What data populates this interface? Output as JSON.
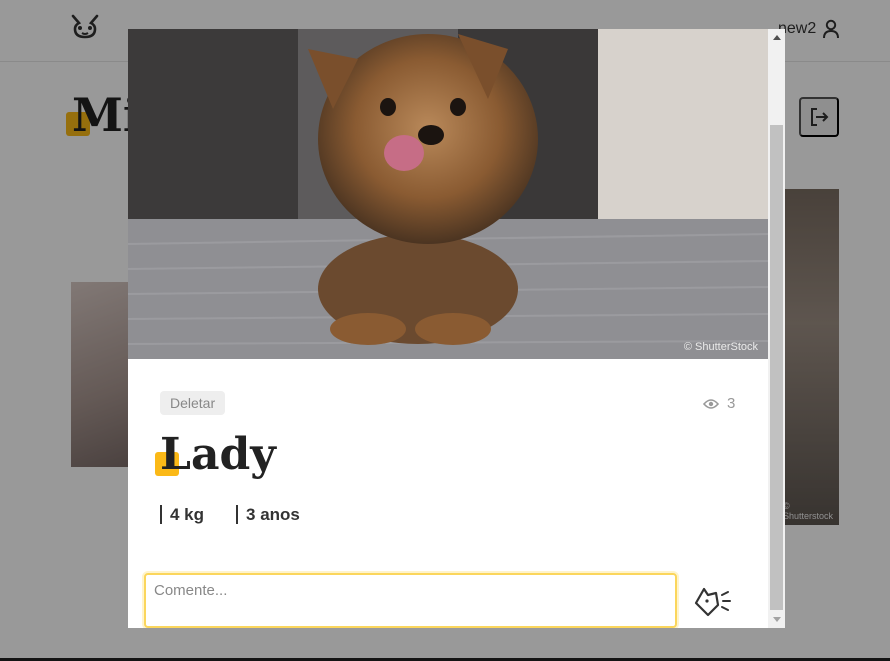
{
  "header": {
    "logo_icon": "dog-face-icon",
    "username": "new2",
    "user_icon": "user-icon"
  },
  "background_page": {
    "title": "Mi",
    "logout_icon": "logout-icon",
    "right_photo_watermark": "© Shutterstock"
  },
  "modal": {
    "photo_alt": "Yorkshire terrier lying on a gray sofa",
    "photo_watermark": "© ShutterStock",
    "delete_label": "Deletar",
    "views_icon": "eye-icon",
    "views_count": "3",
    "dog_name": "Lady",
    "weight": "4 kg",
    "age": "3 anos",
    "comment_placeholder": "Comente...",
    "send_icon": "dog-barking-send-icon"
  },
  "colors": {
    "accent": "#fbb917",
    "overlay": "rgba(0,0,0,0.4)"
  }
}
